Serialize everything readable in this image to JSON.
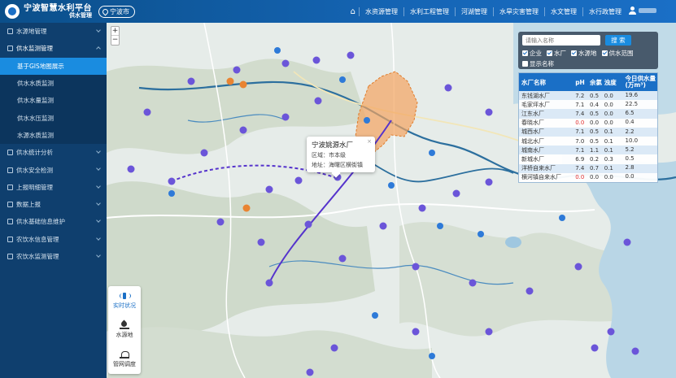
{
  "header": {
    "title": "宁波智慧水利平台",
    "subtitle": "供水管理",
    "city": "宁波市",
    "nav": [
      "水资源管理",
      "水利工程管理",
      "河湖管理",
      "水旱灾害管理",
      "水文管理",
      "水行政管理"
    ]
  },
  "sidebar": {
    "items": [
      {
        "label": "水源地管理",
        "open": false
      },
      {
        "label": "供水监测管理",
        "open": true,
        "children": [
          "基于GIS地图展示",
          "供水水质监测",
          "供水水量监测",
          "供水水压监测",
          "水源水质监测"
        ]
      },
      {
        "label": "供水统计分析",
        "open": false
      },
      {
        "label": "供水安全检测",
        "open": false
      },
      {
        "label": "上报明细管理",
        "open": false
      },
      {
        "label": "数据上报",
        "open": false
      },
      {
        "label": "供水基础信息维护",
        "open": false
      },
      {
        "label": "农饮水信息管理",
        "open": false
      },
      {
        "label": "农饮水监测管理",
        "open": false
      }
    ]
  },
  "filter": {
    "placeholder": "请输入名称",
    "search_label": "搜 索",
    "checks": [
      "企业",
      "水厂",
      "水源地",
      "供水范围"
    ],
    "show_name": "显示名称"
  },
  "table": {
    "headers": [
      "水厂名称",
      "pH",
      "余氯",
      "浊度",
      "今日供水量(万m³)"
    ],
    "rows": [
      [
        "东钱湖水厂",
        "7.2",
        "0.5",
        "0.0",
        "19.6"
      ],
      [
        "毛家坪水厂",
        "7.1",
        "0.4",
        "0.0",
        "22.5"
      ],
      [
        "江东水厂",
        "7.4",
        "0.5",
        "0.0",
        "6.5"
      ],
      [
        "春晓水厂",
        "0.0",
        "0.0",
        "0.0",
        "0.4"
      ],
      [
        "城西水厂",
        "7.1",
        "0.5",
        "0.1",
        "2.2"
      ],
      [
        "城北水厂",
        "7.0",
        "0.5",
        "0.1",
        "10.0"
      ],
      [
        "城南水厂",
        "7.1",
        "1.1",
        "0.1",
        "5.2"
      ],
      [
        "新城水厂",
        "6.9",
        "0.2",
        "0.3",
        "0.5"
      ],
      [
        "洋桥自来水厂",
        "7.4",
        "0.7",
        "0.1",
        "2.8"
      ],
      [
        "横河镇自来水厂",
        "0.0",
        "0.0",
        "0.0",
        "0.0"
      ]
    ]
  },
  "popup": {
    "title": "宁波姚源水厂",
    "area": "区域：市本级",
    "address": "地址：海曙区横街镇"
  },
  "toolbox": [
    "实时状况",
    "水源地",
    "管网调度"
  ],
  "map_labels": [
    "宁波市"
  ],
  "colors": {
    "header": "#1565b5",
    "sidebar": "#0f3f6e",
    "active": "#1a8ce0",
    "range": "#f4a460"
  }
}
